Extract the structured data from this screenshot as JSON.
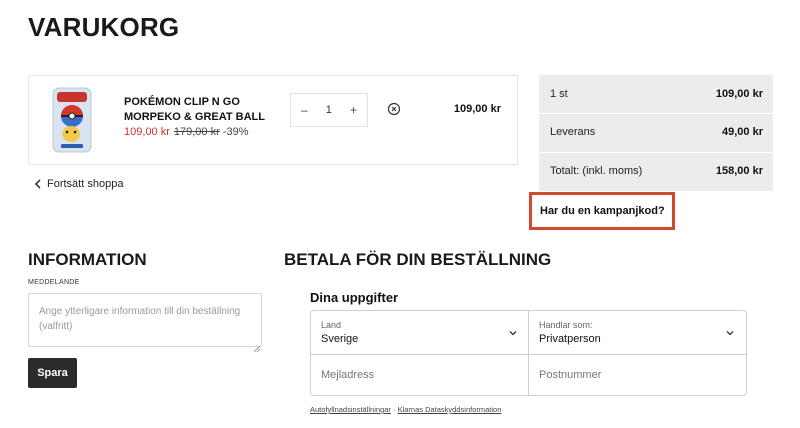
{
  "page": {
    "title": "VARUKORG"
  },
  "cart": {
    "item": {
      "name": "POKÉMON CLIP N GO MORPEKO & GREAT BALL",
      "sale_price": "109,00 kr",
      "old_price": "179,00 kr",
      "discount": "-39%",
      "quantity": "1",
      "qty_minus": "–",
      "qty_plus": "+",
      "line_total": "109,00 kr",
      "remove_icon": "circle-x-icon"
    },
    "continue_label": "Fortsätt shoppa"
  },
  "summary": {
    "rows": [
      {
        "label": "1 st",
        "value": "109,00 kr"
      },
      {
        "label": "Leverans",
        "value": "49,00 kr"
      },
      {
        "label": "Totalt: (inkl. moms)",
        "value": "158,00 kr"
      }
    ],
    "promo_label": "Har du en kampanjkod?",
    "background": "#ececec",
    "highlight_color": "#d24a2e"
  },
  "information": {
    "title": "INFORMATION",
    "message_label": "MEDDELANDE",
    "message_placeholder": "Ange ytterligare information till din beställning (valfritt)",
    "save_label": "Spara"
  },
  "checkout": {
    "title": "BETALA FÖR DIN BESTÄLLNING",
    "section_title": "Dina uppgifter",
    "country_label": "Land",
    "country_value": "Sverige",
    "buyer_label": "Handlar som:",
    "buyer_value": "Privatperson",
    "email_placeholder": "Mejladress",
    "postcode_placeholder": "Postnummer",
    "autofill_link": "Autofyllnadsinställningar",
    "separator": "·",
    "privacy_link": "Klarnas Dataskyddsinformation"
  },
  "colors": {
    "sale": "#d0322f",
    "button": "#2b2b2b"
  }
}
